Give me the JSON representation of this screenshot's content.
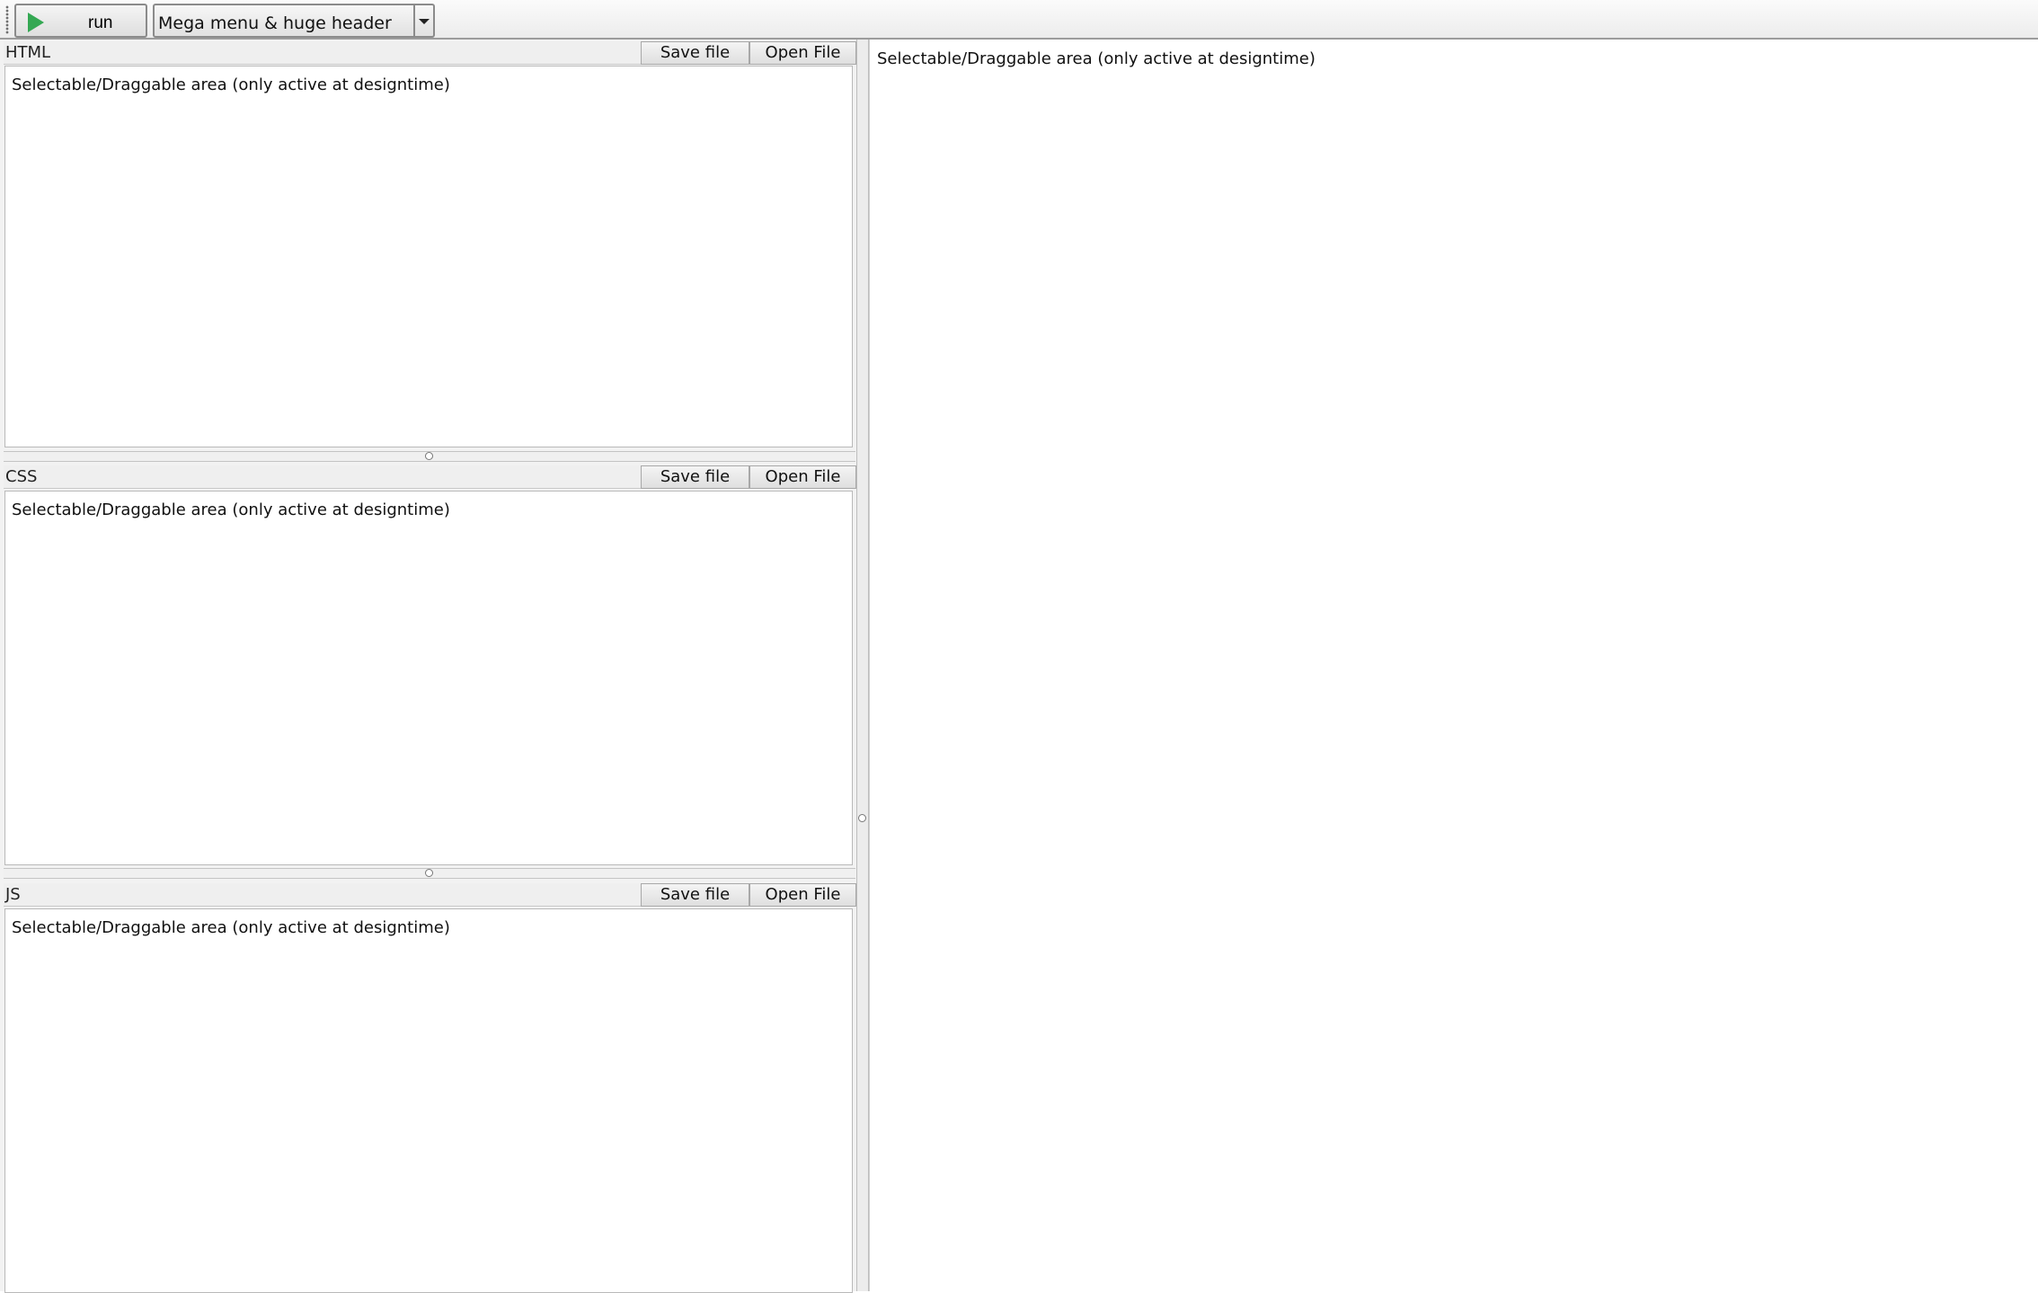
{
  "toolbar": {
    "run_label": "run",
    "preset_selected": "Mega menu & huge header",
    "run_icon_color": "#34a853"
  },
  "panels": [
    {
      "title": "HTML",
      "save_label": "Save file",
      "open_label": "Open File",
      "area_text": "Selectable/Draggable area (only active at designtime)"
    },
    {
      "title": "CSS",
      "save_label": "Save file",
      "open_label": "Open File",
      "area_text": "Selectable/Draggable area (only active at designtime)"
    },
    {
      "title": "JS",
      "save_label": "Save file",
      "open_label": "Open File",
      "area_text": "Selectable/Draggable area (only active at designtime)"
    }
  ],
  "preview": {
    "area_text": "Selectable/Draggable area (only active at designtime)"
  }
}
